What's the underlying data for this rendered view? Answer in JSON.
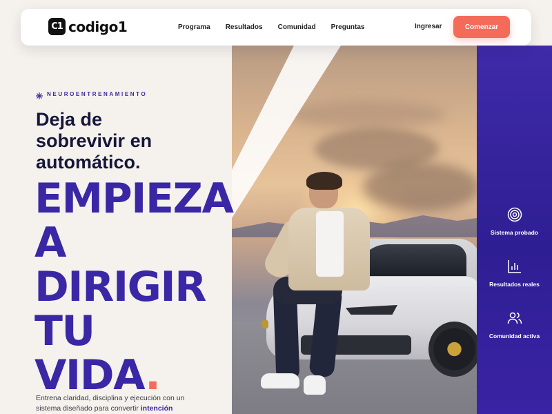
{
  "brand": {
    "logo_mark": "C1",
    "name": "codigo1"
  },
  "nav": {
    "links": [
      "Programa",
      "Resultados",
      "Comunidad",
      "Preguntas"
    ],
    "login": "Ingresar",
    "cta": "Comenzar"
  },
  "hero": {
    "eyebrow": "NEUROENTRENAMIENTO",
    "subhead_lines": [
      "Deja de",
      "sobrevivir en",
      "automático."
    ],
    "headline_lines": [
      "EMPIEZA",
      "A",
      "DIRIGIR",
      "TU",
      "VIDA"
    ],
    "headline_end": ".",
    "desc_prefix": "Entrena claridad, disciplina y ejecución con un sistema diseñado para convertir ",
    "desc_highlight": "intención"
  },
  "features": [
    {
      "icon": "target-icon",
      "label": "Sistema probado"
    },
    {
      "icon": "bar-chart-icon",
      "label": "Resultados reales"
    },
    {
      "icon": "users-icon",
      "label": "Comunidad activa"
    }
  ],
  "colors": {
    "accent": "#f46b5a",
    "brand_purple": "#3a27a6",
    "navy": "#15163a",
    "background": "#f5f1ec"
  }
}
